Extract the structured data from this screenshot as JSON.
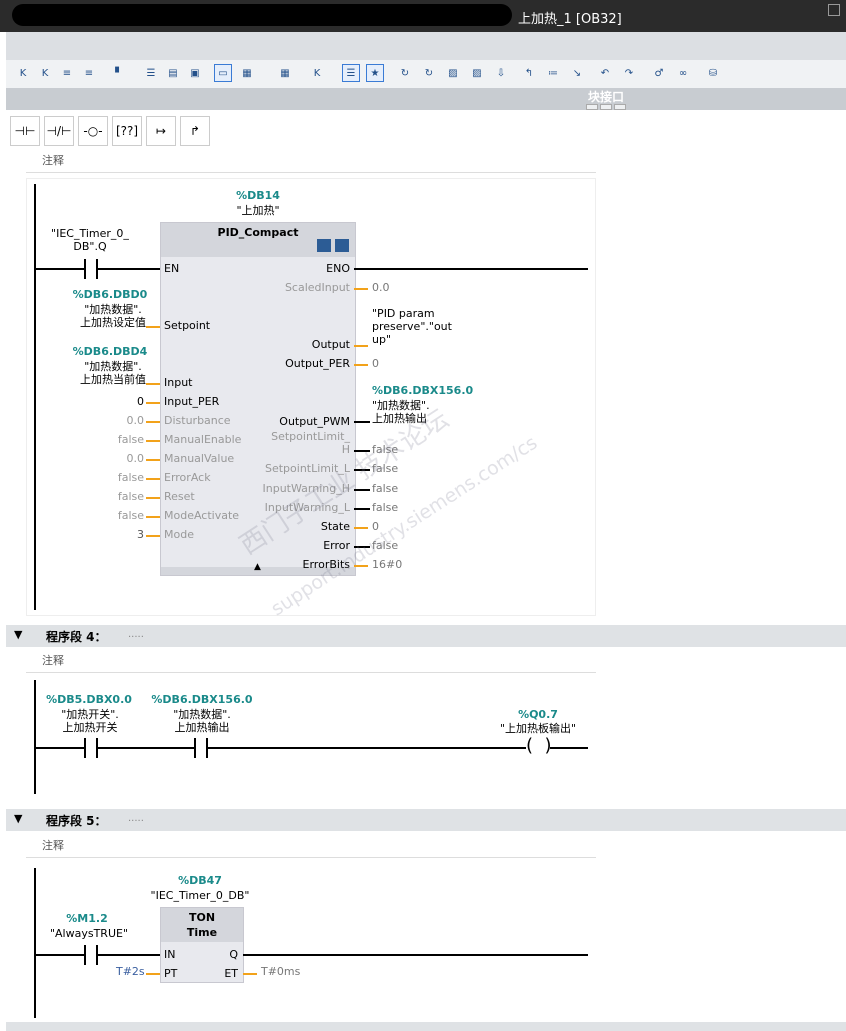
{
  "window": {
    "title": "上加热_1 [OB32]"
  },
  "interface_bar": {
    "label": "块接口"
  },
  "ladder_toolbar": {
    "items": [
      "⊣⊢",
      "⊣/⊢",
      "-○-",
      "[??]",
      "↦",
      "↱"
    ]
  },
  "network3": {
    "comment": "注释",
    "db_addr": "%DB14",
    "db_name": "\"上加热\"",
    "block_title": "PID_Compact",
    "en_contact": {
      "name": "\"IEC_Timer_0_\nDB\".Q"
    },
    "inputs": [
      {
        "pin": "EN",
        "value": "",
        "active": true
      },
      {
        "pin": "Setpoint",
        "addr": "%DB6.DBD0",
        "name": "\"加热数据\".\n上加热设定值",
        "active": true
      },
      {
        "pin": "Input",
        "addr": "%DB6.DBD4",
        "name": "\"加热数据\".\n上加热当前值",
        "active": true
      },
      {
        "pin": "Input_PER",
        "value": "0",
        "active": true
      },
      {
        "pin": "Disturbance",
        "value": "0.0",
        "active": false
      },
      {
        "pin": "ManualEnable",
        "value": "false",
        "active": false
      },
      {
        "pin": "ManualValue",
        "value": "0.0",
        "active": false
      },
      {
        "pin": "ErrorAck",
        "value": "false",
        "active": false
      },
      {
        "pin": "Reset",
        "value": "false",
        "active": false
      },
      {
        "pin": "ModeActivate",
        "value": "false",
        "active": false
      },
      {
        "pin": "Mode",
        "value": "3",
        "active": false
      }
    ],
    "outputs": [
      {
        "pin": "ENO",
        "value": ""
      },
      {
        "pin": "ScaledInput",
        "value": "0.0"
      },
      {
        "pin": "Output",
        "value": "\"PID param\npreserve\".\"out\nup\""
      },
      {
        "pin": "Output_PER",
        "value": "0"
      },
      {
        "pin": "Output_PWM",
        "addr": "%DB6.DBX156.0",
        "name": "\"加热数据\".\n上加热输出"
      },
      {
        "pin": "SetpointLimit_\nH",
        "value": "false"
      },
      {
        "pin": "SetpointLimit_L",
        "value": "false"
      },
      {
        "pin": "InputWarning_H",
        "value": "false"
      },
      {
        "pin": "InputWarning_L",
        "value": "false"
      },
      {
        "pin": "State",
        "value": "0"
      },
      {
        "pin": "Error",
        "value": "false"
      },
      {
        "pin": "ErrorBits",
        "value": "16#0"
      }
    ]
  },
  "network4": {
    "title": "程序段 4：",
    "desc": ".....",
    "comment": "注释",
    "contact1": {
      "addr": "%DB5.DBX0.0",
      "name": "\"加热开关\".\n上加热开关"
    },
    "contact2": {
      "addr": "%DB6.DBX156.0",
      "name": "\"加热数据\".\n上加热输出"
    },
    "coil": {
      "addr": "%Q0.7",
      "name": "\"上加热板输出\""
    }
  },
  "network5": {
    "title": "程序段 5：",
    "desc": ".....",
    "comment": "注释",
    "db_addr": "%DB47",
    "db_name": "\"IEC_Timer_0_DB\"",
    "block_title": "TON",
    "block_sub": "Time",
    "contact": {
      "addr": "%M1.2",
      "name": "\"AlwaysTRUE\""
    },
    "in_pin": "IN",
    "pt_pin": "PT",
    "pt_value": "T#2s",
    "q_pin": "Q",
    "et_pin": "ET",
    "et_value": "T#0ms"
  },
  "watermark": {
    "line1": "西门子工业  技术论坛",
    "line2": "support.industry.siemens.com/cs"
  }
}
